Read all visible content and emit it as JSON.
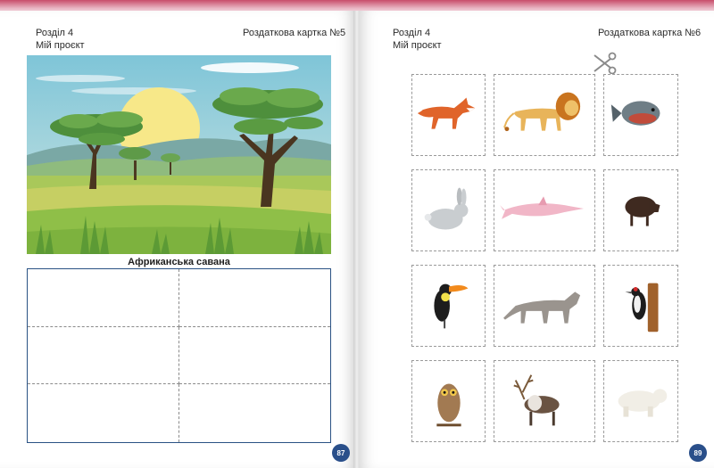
{
  "left_page": {
    "section": "Розділ 4",
    "project": "Мій проєкт",
    "card_title": "Роздаткова картка №5",
    "table_title": "Африканська савана",
    "page_number": "87"
  },
  "right_page": {
    "section": "Розділ 4",
    "project": "Мій проєкт",
    "card_title": "Роздаткова картка №6",
    "page_number": "89"
  },
  "animals": [
    "fox",
    "lion",
    "piranha",
    "rabbit",
    "river-dolphin",
    "wild-boar",
    "toucan",
    "cougar",
    "woodpecker",
    "owl",
    "reindeer",
    "polar-bear"
  ],
  "colors": {
    "accent": "#2a4f8a",
    "top_band": "#c84d6a"
  }
}
